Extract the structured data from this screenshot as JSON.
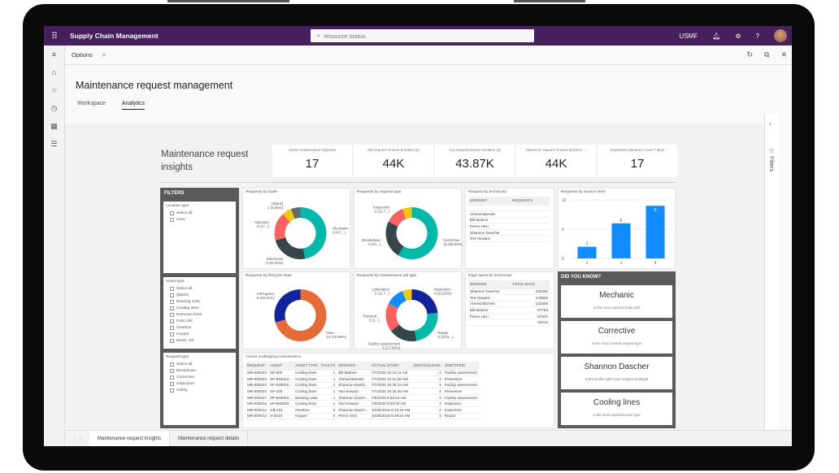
{
  "app": {
    "title": "Supply Chain Management",
    "company": "USMF"
  },
  "search": {
    "placeholder": "resource status"
  },
  "toolbar": {
    "options_label": "Options"
  },
  "page": {
    "title": "Maintenance request management",
    "tabs": [
      {
        "label": "Workspace"
      },
      {
        "label": "Analytics"
      }
    ]
  },
  "report": {
    "title": "Maintenance request insights",
    "kpis": [
      {
        "label": "Active maintenance requests",
        "value": "17"
      },
      {
        "label": "Min request closure duration (d)",
        "value": "44K"
      },
      {
        "label": "Avg request closure duration (d)",
        "value": "43.87K"
      },
      {
        "label": "Maximum request closure duration ...",
        "value": "44K"
      },
      {
        "label": "Downtime planned in next 7 days",
        "value": "17"
      }
    ],
    "filters": {
      "header": "FILTERS",
      "location": {
        "title": "Location type",
        "items": [
          "Select all",
          "Area"
        ]
      },
      "asset": {
        "title": "Asset type",
        "items": [
          "Select all",
          "(Blank)",
          "Brewing units",
          "Cooling lines",
          "Extrusion lines",
          "Fork Lifts",
          "Gearbox",
          "Hopper",
          "Motor- DC"
        ]
      },
      "request": {
        "title": "Request type",
        "items": [
          "Select all",
          "Breakdown",
          "Corrective",
          "Inspection",
          "Safety"
        ]
      }
    },
    "filters_pane_label": "Filters"
  },
  "chart_data": [
    {
      "type": "pie",
      "title": "Requests by trade",
      "donut": true,
      "slices": [
        {
          "label": "Mechanic",
          "value": 8,
          "display": "8 (47...)",
          "color": "#01b8aa"
        },
        {
          "label": "Electrician",
          "value": 4,
          "display": "4 (23.53%)",
          "color": "#374649"
        },
        {
          "label": "Operator",
          "value": 3,
          "display": "3 (17...)",
          "color": "#fd625e"
        },
        {
          "label": "(Blank)",
          "value": 1,
          "display": "1 (5.88%)",
          "color": "#f2c80f"
        },
        {
          "label": "",
          "value": 1,
          "display": "",
          "color": "#5f6b6d"
        }
      ]
    },
    {
      "type": "pie",
      "title": "Requests by request type",
      "donut": true,
      "slices": [
        {
          "label": "Corrective",
          "value": 10,
          "display": "10 (58.82%)",
          "color": "#01b8aa"
        },
        {
          "label": "Breakdown",
          "value": 4,
          "display": "4 (23...)",
          "color": "#374649"
        },
        {
          "label": "Inspection",
          "value": 2,
          "display": "2 (11.7...)",
          "color": "#fd625e"
        },
        {
          "label": "",
          "value": 1,
          "display": "",
          "color": "#f2c80f"
        }
      ]
    },
    {
      "type": "pie",
      "title": "Requests by lifecycle state",
      "donut": true,
      "slices": [
        {
          "label": "New",
          "value": 12,
          "display": "12 (70.59%)",
          "color": "#e66c37"
        },
        {
          "label": "InProgress",
          "value": 5,
          "display": "5 (29.41%)",
          "color": "#12239e"
        }
      ]
    },
    {
      "type": "pie",
      "title": "Requests by maintenance job type",
      "donut": true,
      "slices": [
        {
          "label": "Inspection",
          "value": 4,
          "display": "4 (23.53%)",
          "color": "#12239e"
        },
        {
          "label": "Repair",
          "value": 4,
          "display": "4 (23.5...)",
          "color": "#01b8aa"
        },
        {
          "label": "Facility assessment",
          "value": 3,
          "display": "3 (17.65%)",
          "color": "#374649"
        },
        {
          "label": "Preventi...",
          "value": 3,
          "display": "3 (1...)",
          "color": "#fd625e"
        },
        {
          "label": "Lubrication",
          "value": 2,
          "display": "2 (11.7...)",
          "color": "#118dff"
        },
        {
          "label": "",
          "value": 1,
          "display": "",
          "color": "#f2c80f"
        }
      ]
    },
    {
      "type": "bar",
      "title": "Requests by service level",
      "categories": [
        "2",
        "3",
        "4"
      ],
      "values": [
        2,
        6,
        9
      ],
      "ylim": [
        0,
        10
      ],
      "yticks": [
        "0",
        "5",
        "10"
      ],
      "color": "#118dff"
    },
    {
      "type": "table",
      "title": "Request by technician",
      "columns": [
        "WORKER",
        "REQUESTS"
      ],
      "rows": [
        [
          "",
          ""
        ],
        [
          "Ahmed Barnett",
          ""
        ],
        [
          "Bill Malone",
          ""
        ],
        [
          "Pierre Hezi",
          ""
        ],
        [
          "Shannon Dascher",
          ""
        ],
        [
          "Ted Howard",
          ""
        ]
      ]
    },
    {
      "type": "table",
      "title": "Days spent by technician",
      "columns": [
        "WORKER",
        "TOTAL DAYS"
      ],
      "rows": [
        [
          "Shannon Dascher",
          "219330"
        ],
        [
          "Ted Howard",
          "175563"
        ],
        [
          "Ahmed Barnett",
          "131549"
        ],
        [
          "Bill Malone",
          "87783"
        ],
        [
          "Pierre Hezi",
          "87532"
        ],
        [
          "",
          "44016"
        ]
      ]
    },
    {
      "type": "table",
      "title": "Assets undergoing maintenance",
      "columns": [
        "REQUEST",
        "ASSET",
        "ASSET TYPE",
        "FAULTS",
        "WORKER",
        "ACTUAL START",
        "SERVICELEVEL",
        "JOBTYPEID"
      ],
      "rows": [
        [
          "MR-000024",
          "SP-600",
          "Cooling lines",
          "1",
          "Bill Malone",
          "7/7/2020 10:34:11 AM",
          "4",
          "Facility assessment"
        ],
        [
          "MR-000023",
          "SP-BOM10...",
          "Cooling lines",
          "1",
          "Ahmed Barnett",
          "7/7/2020 10:31:39 AM",
          "4",
          "Preventive"
        ],
        [
          "MR-000022",
          "SP-BOM10...",
          "Cooling lines",
          "1",
          "Shannon Dasch...",
          "7/7/2020 10:28:13 AM",
          "4",
          "Facility assessment"
        ],
        [
          "MR-000020",
          "SP-200",
          "Cooling lines",
          "1",
          "Ted Howard",
          "7/7/2020 10:25:48 AM",
          "4",
          "Preventive"
        ],
        [
          "MR-000017",
          "SP-BOM10...",
          "Brewing units",
          "1",
          "Shannon Dasch...",
          "7/8/2020 9:29:13 AM",
          "3",
          "Facility assessment"
        ],
        [
          "MR-000016",
          "SP-BOM10...",
          "Cooling lines",
          "1",
          "Ted Howard",
          "7/8/2020 9:00:09 AM",
          "3",
          "Inspection"
        ],
        [
          "MR-000014",
          "GB-101",
          "Gearbox",
          "0",
          "Shannon Dasch...",
          "10/30/2019 8:43:18 AM",
          "4",
          "Inspection"
        ],
        [
          "MR-000013",
          "H-3010",
          "Hopper",
          "0",
          "Pierre Hezi",
          "10/30/2019 8:29:44 AM",
          "3",
          "Repair"
        ]
      ]
    }
  ],
  "did_you_know": {
    "header": "DID YOU KNOW?",
    "cards": [
      {
        "value": "Mechanic",
        "caption": "is the most required trade skill"
      },
      {
        "value": "Corrective",
        "caption": "is the most created request type"
      },
      {
        "value": "Shannon Dascher",
        "caption": "is the worker with most request workload"
      },
      {
        "value": "Cooling lines",
        "caption": "is the most repaired asset type"
      }
    ]
  },
  "bottom_tabs": [
    {
      "label": "Maintenance request insights",
      "active": true
    },
    {
      "label": "Maintenance request details",
      "active": false
    }
  ]
}
